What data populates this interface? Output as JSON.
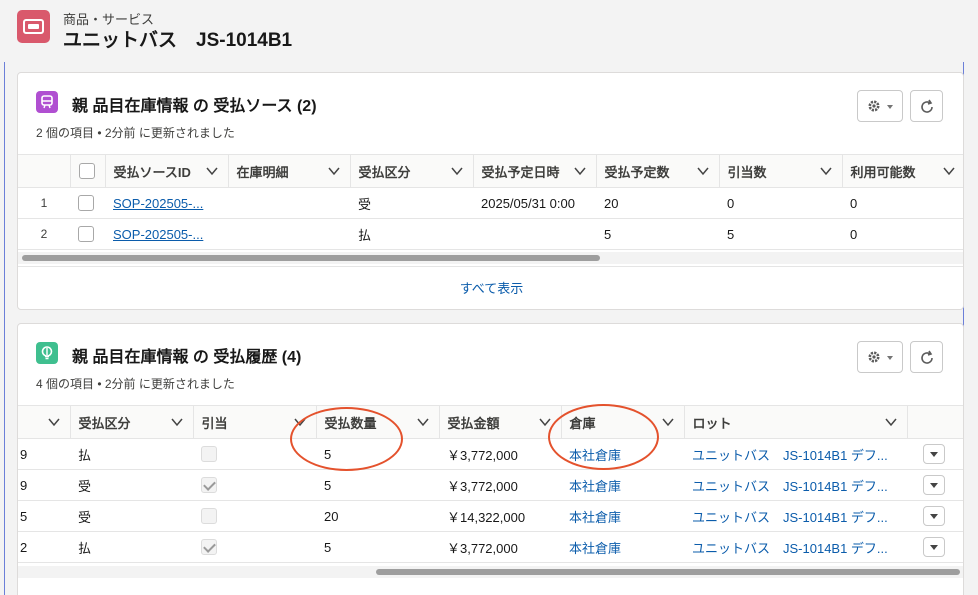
{
  "header": {
    "object_type": "商品・サービス",
    "record_title": "ユニットバス　JS-1014B1"
  },
  "card1": {
    "title": "親 品目在庫情報 の 受払ソース (2)",
    "subtitle": "2 個の項目 • 2分前 に更新されました",
    "columns": [
      "受払ソースID",
      "在庫明細",
      "受払区分",
      "受払予定日時",
      "受払予定数",
      "引当数",
      "利用可能数"
    ],
    "rows": [
      {
        "num": "1",
        "id": "SOP-202505-...",
        "detail": "",
        "type": "受",
        "date": "2025/05/31 0:00",
        "planned": "20",
        "allocated": "0",
        "available": "0"
      },
      {
        "num": "2",
        "id": "SOP-202505-...",
        "detail": "",
        "type": "払",
        "date": "",
        "planned": "5",
        "allocated": "5",
        "available": "0"
      }
    ],
    "view_all": "すべて表示"
  },
  "card2": {
    "title": "親 品目在庫情報 の 受払履歴 (4)",
    "subtitle": "4 個の項目 • 2分前 に更新されました",
    "columns": [
      "受払区分",
      "引当",
      "受払数量",
      "受払金額",
      "倉庫",
      "ロット"
    ],
    "rows": [
      {
        "num": "9",
        "type": "払",
        "allocated": false,
        "qty": "5",
        "amount": "￥3,772,000",
        "warehouse": "本社倉庫",
        "lot": "ユニットバス　JS-1014B1 デフ..."
      },
      {
        "num": "9",
        "type": "受",
        "allocated": true,
        "qty": "5",
        "amount": "￥3,772,000",
        "warehouse": "本社倉庫",
        "lot": "ユニットバス　JS-1014B1 デフ..."
      },
      {
        "num": "5",
        "type": "受",
        "allocated": false,
        "qty": "20",
        "amount": "￥14,322,000",
        "warehouse": "本社倉庫",
        "lot": "ユニットバス　JS-1014B1 デフ..."
      },
      {
        "num": "2",
        "type": "払",
        "allocated": true,
        "qty": "5",
        "amount": "￥3,772,000",
        "warehouse": "本社倉庫",
        "lot": "ユニットバス　JS-1014B1 デフ..."
      }
    ]
  },
  "colors": {
    "object_icon": "#d9596c",
    "card1_icon": "#b04fd1",
    "card2_icon": "#3fbf8f",
    "link": "#0b5cab",
    "annotation": "#e4522d"
  }
}
